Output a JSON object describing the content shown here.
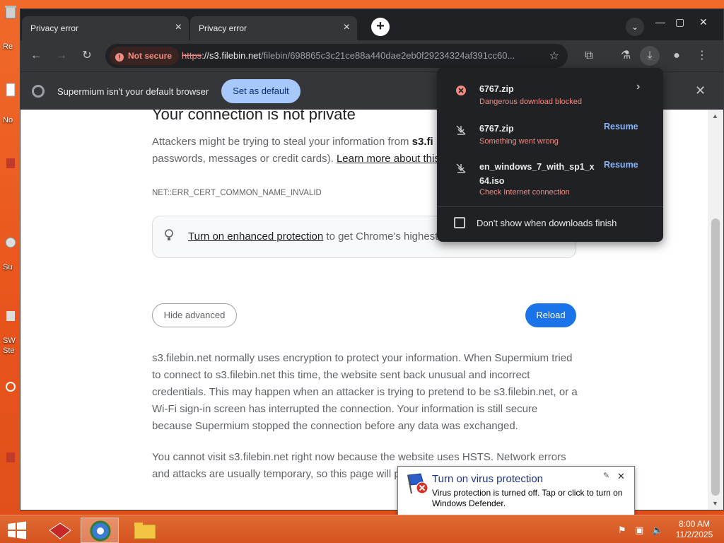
{
  "desktop": {
    "labels": [
      "Re",
      "No",
      "Su",
      "SW",
      "Ste"
    ]
  },
  "browser": {
    "tabs": [
      {
        "label": "Privacy error"
      },
      {
        "label": "Privacy error"
      }
    ],
    "new_tab_symbol": "+",
    "omnibox": {
      "security_label": "Not secure",
      "url_scheme": "https",
      "url_host": "://s3.filebin.net",
      "url_path": "/filebin/698865c3c21ce88a440dae2eb0f29234324af391cc60..."
    },
    "infobar": {
      "message": "Supermium isn't your default browser",
      "button": "Set as default"
    }
  },
  "page": {
    "heading": "Your connection is not private",
    "intro_prefix": "Attackers might be trying to steal your information from ",
    "intro_host": "s3.fi",
    "intro_line2_prefix": "passwords, messages or credit cards). ",
    "intro_link": "Learn more about this w",
    "error_code": "NET::ERR_CERT_COMMON_NAME_INVALID",
    "enhanced_link": "Turn on enhanced protection",
    "enhanced_text": " to get Chrome's highest",
    "hide_advanced": "Hide advanced",
    "reload": "Reload",
    "advanced_p1_l1": "s3.filebin.net normally uses encryption to protect your information. When Supermium tried",
    "advanced_p1_l2": "to connect to s3.filebin.net this time, the website sent back unusual and incorrect",
    "advanced_p1_l3": "credentials. This may happen when an attacker is trying to pretend to be s3.filebin.net, or a",
    "advanced_p1_l4": "Wi-Fi sign-in screen has interrupted the connection. Your information is still secure",
    "advanced_p1_l5": "because Supermium stopped the connection before any data was exchanged.",
    "advanced_p2_l1": "You cannot visit s3.filebin.net right now because the website uses HSTS. Network errors",
    "advanced_p2_l2": "and attacks are usually temporary, so this page will probably work later."
  },
  "downloads": {
    "items": [
      {
        "name": "6767.zip",
        "status": "Dangerous download blocked",
        "action": ""
      },
      {
        "name": "6767.zip",
        "status": "Something went wrong",
        "action": "Resume"
      },
      {
        "name_l1": "en_windows_7_with_sp1_x",
        "name_l2": "64.iso",
        "status": "Check Internet connection",
        "action": "Resume"
      }
    ],
    "checkbox_label": "Don't show when downloads finish"
  },
  "notification": {
    "title": "Turn on virus protection",
    "body": "Virus protection is turned off. Tap or click to turn on Windows Defender."
  },
  "taskbar": {
    "time": "8:00 AM",
    "date": "11/2/2025"
  },
  "colors": {
    "desktop": "#e8531c",
    "accent_blue": "#1a73e8",
    "danger_red": "#f28b82",
    "link_blue": "#8ab4f8"
  }
}
